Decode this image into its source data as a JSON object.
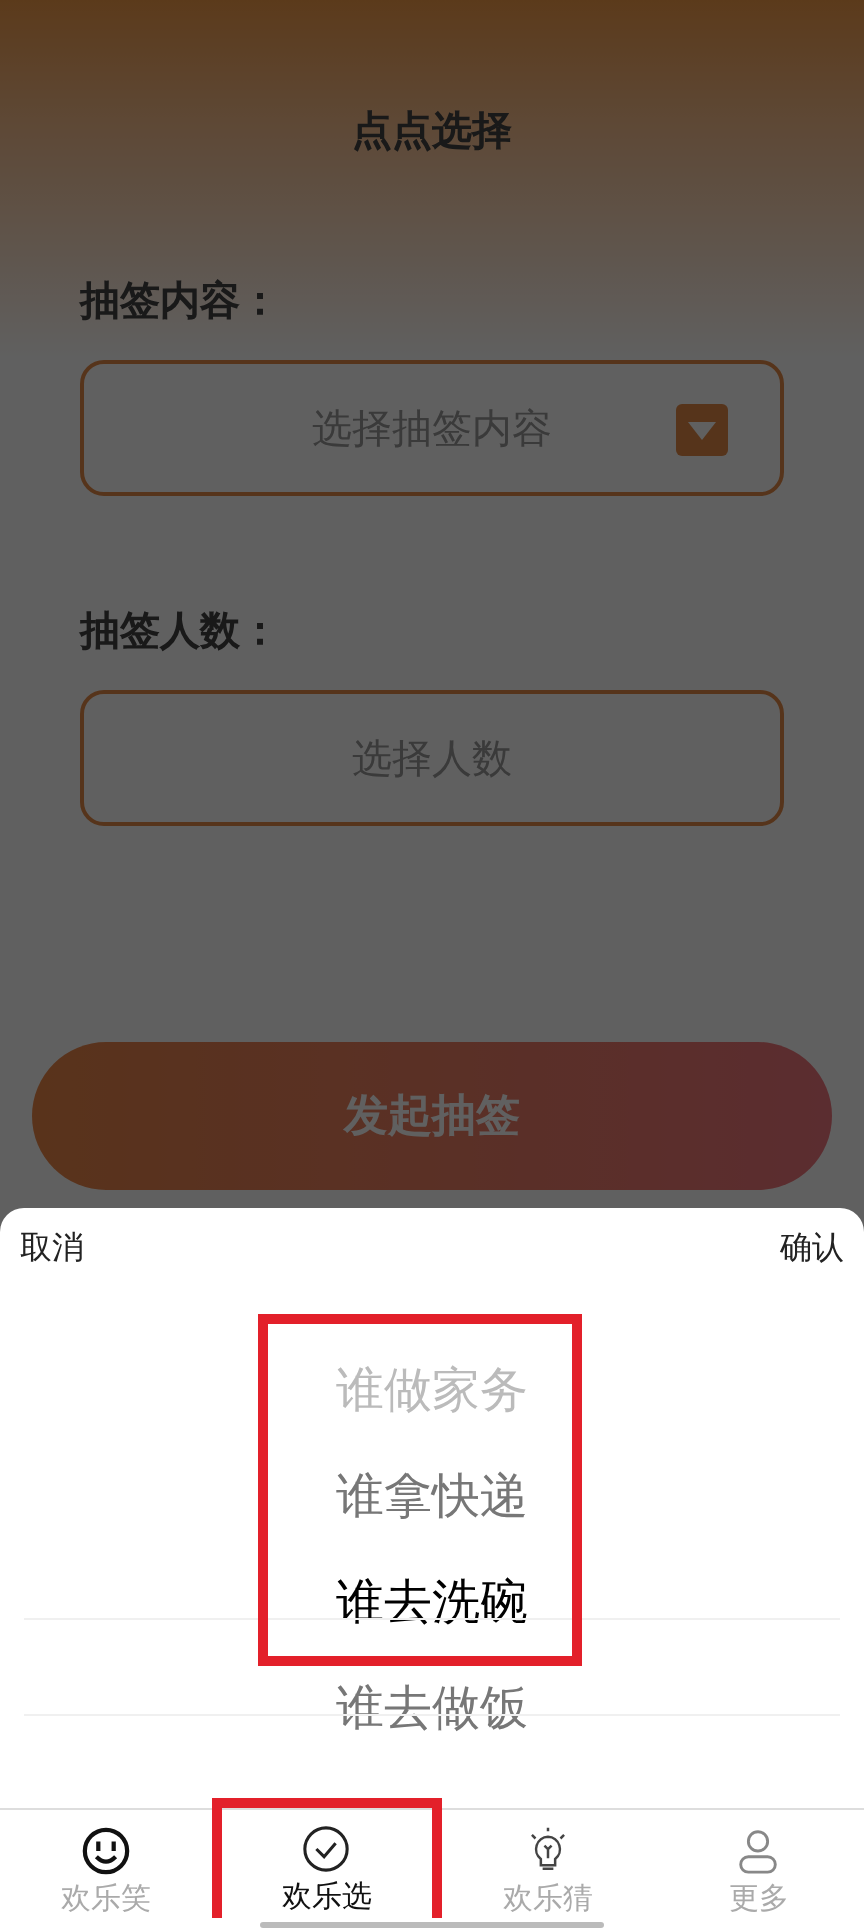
{
  "page": {
    "title": "点点选择",
    "dimmed": true
  },
  "form": [
    {
      "label": "抽签内容：",
      "placeholder": "选择抽签内容",
      "dropdown": true
    },
    {
      "label": "抽签人数：",
      "placeholder": "选择人数",
      "dropdown": false
    }
  ],
  "submit": {
    "label": "发起抽签"
  },
  "sheet": {
    "cancel": "取消",
    "confirm": "确认",
    "highlighted": true,
    "options": [
      {
        "label": "谁做家务",
        "selected": false,
        "faded": true
      },
      {
        "label": "谁拿快递",
        "selected": false,
        "faded": false
      },
      {
        "label": "谁去洗碗",
        "selected": true,
        "faded": false
      },
      {
        "label": "谁去做饭",
        "selected": false,
        "faded": false
      }
    ]
  },
  "tabs": [
    {
      "label": "欢乐笑",
      "kind": "smile",
      "selected": false,
      "highlighted": false
    },
    {
      "label": "欢乐选",
      "kind": "check",
      "selected": true,
      "highlighted": true
    },
    {
      "label": "欢乐猜",
      "kind": "bulb",
      "selected": false,
      "highlighted": false
    },
    {
      "label": "更多",
      "kind": "person",
      "selected": false,
      "highlighted": false
    }
  ]
}
